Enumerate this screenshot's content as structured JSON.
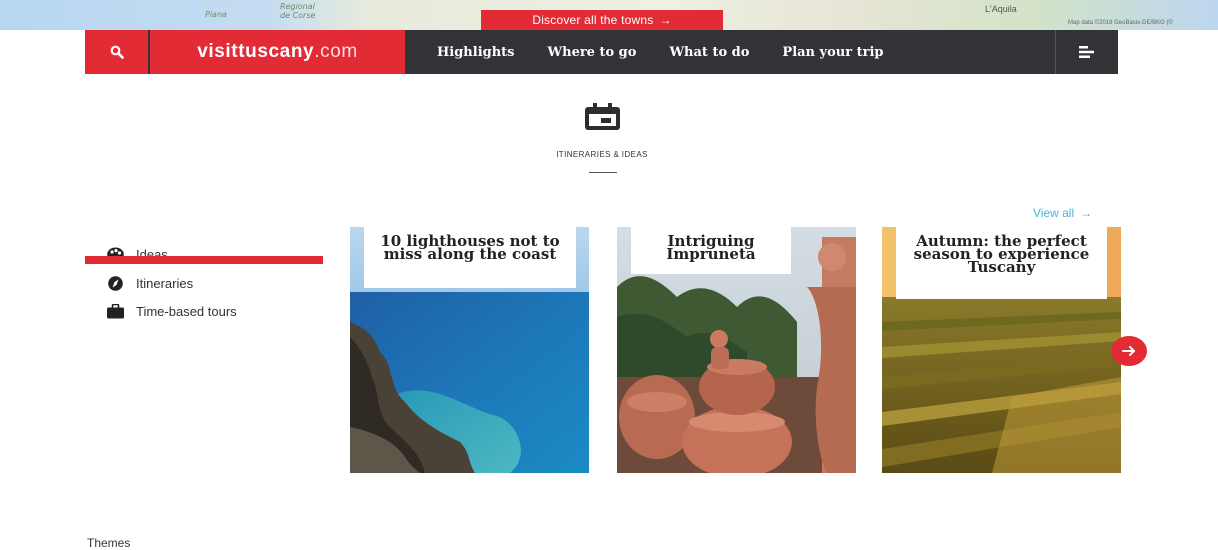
{
  "map": {
    "labels": [
      "Piana",
      "Regional",
      "de Corse"
    ],
    "town": "L'Aquila",
    "copyright": "Map data ©2018 GeoBasis-DE/BKG (©"
  },
  "discover": {
    "label": "Discover all the towns",
    "arrow": "→"
  },
  "nav": {
    "logo_main": "visittuscany",
    "logo_suffix": ".com",
    "links": [
      "Highlights",
      "Where to go",
      "What to do",
      "Plan your trip"
    ]
  },
  "section": {
    "icon": "calendar-icon",
    "title": "ITINERARIES & IDEAS"
  },
  "view_all": {
    "label": "View all",
    "arrow": "→"
  },
  "side_menu": [
    {
      "label": "Ideas",
      "icon": "palette-icon",
      "active": true
    },
    {
      "label": "Itineraries",
      "icon": "compass-icon",
      "active": false
    },
    {
      "label": "Time-based tours",
      "icon": "briefcase-icon",
      "active": false
    }
  ],
  "cards": [
    {
      "title": "10 lighthouses not to miss along the coast"
    },
    {
      "title": "Intriguing Impruneta"
    },
    {
      "title": "Autumn: the perfect season to experience Tuscany"
    }
  ],
  "footer": {
    "themes": "Themes"
  },
  "colors": {
    "brand_red": "#e32b36",
    "nav_dark": "#333236",
    "link_blue": "#4db3d6"
  }
}
